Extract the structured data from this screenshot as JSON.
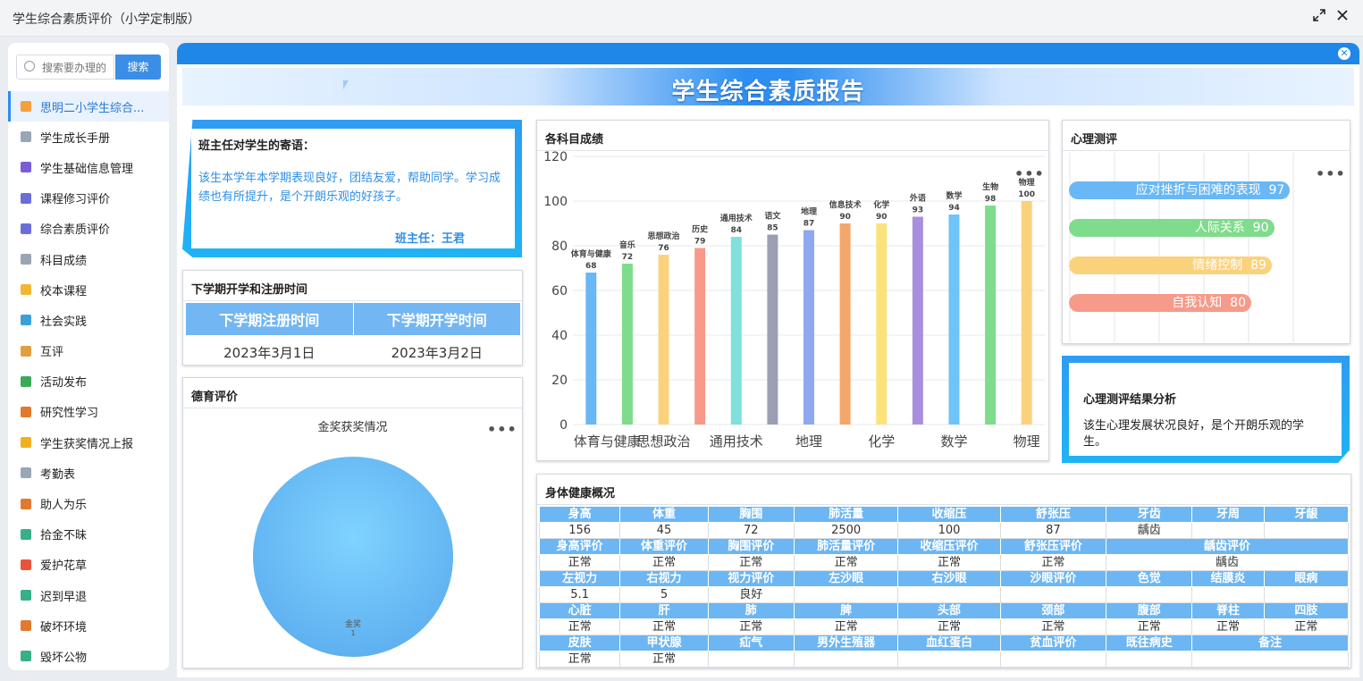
{
  "window": {
    "title": "学生综合素质评价（小学定制版）"
  },
  "sidebar": {
    "search_placeholder": "搜索要办理的",
    "search_button": "搜索",
    "items": [
      {
        "label": "思明二小学生综合...",
        "color": "#f5a03a"
      },
      {
        "label": "学生成长手册",
        "color": "#9aa5b5"
      },
      {
        "label": "学生基础信息管理",
        "color": "#7b5bd6"
      },
      {
        "label": "课程修习评价",
        "color": "#6a6fd8"
      },
      {
        "label": "综合素质评价",
        "color": "#6a6fd8"
      },
      {
        "label": "科目成绩",
        "color": "#9aa5b5"
      },
      {
        "label": "校本课程",
        "color": "#f2b630"
      },
      {
        "label": "社会实践",
        "color": "#3aa0d8"
      },
      {
        "label": "互评",
        "color": "#e0a040"
      },
      {
        "label": "活动发布",
        "color": "#3aaa5a"
      },
      {
        "label": "研究性学习",
        "color": "#e07a30"
      },
      {
        "label": "学生获奖情况上报",
        "color": "#f0b020"
      },
      {
        "label": "考勤表",
        "color": "#9aa5b5"
      },
      {
        "label": "助人为乐",
        "color": "#e07a30"
      },
      {
        "label": "拾金不昧",
        "color": "#35b089"
      },
      {
        "label": "爱护花草",
        "color": "#e8543a"
      },
      {
        "label": "迟到早退",
        "color": "#35b089"
      },
      {
        "label": "破坏环境",
        "color": "#e07a30"
      },
      {
        "label": "毁坏公物",
        "color": "#35b089"
      }
    ]
  },
  "report": {
    "title": "学生综合素质报告"
  },
  "teacher_comment": {
    "title": "班主任对学生的寄语：",
    "text": "该生本学年本学期表现良好，团结友爱，帮助同学。学习成绩也有所提升，是个开朗乐观的好孩子。",
    "signature": "班主任：王君"
  },
  "registration": {
    "title": "下学期开学和注册时间",
    "headers": [
      "下学期注册时间",
      "下学期开学时间"
    ],
    "values": [
      "2023年3月1日",
      "2023年3月2日"
    ]
  },
  "moral": {
    "title": "德育评价",
    "chart_title": "金奖获奖情况",
    "slice_label": "金奖",
    "slice_value": "1"
  },
  "scores": {
    "title": "各科目成绩",
    "more": "•••"
  },
  "psychology": {
    "title": "心理测评",
    "more": "•••",
    "bars": [
      {
        "label": "应对挫折与困难的表现",
        "value": "97"
      },
      {
        "label": "人际关系",
        "value": "90"
      },
      {
        "label": "情绪控制",
        "value": "89"
      },
      {
        "label": "自我认知",
        "value": "80"
      }
    ]
  },
  "analysis": {
    "title": "心理测评结果分析",
    "text": "该生心理发展状况良好，是个开朗乐观的学生。"
  },
  "health": {
    "title": "身体健康概况",
    "rows": [
      [
        "身高",
        "体重",
        "胸围",
        "肺活量",
        "收缩压",
        "舒张压",
        "牙齿",
        "牙周",
        "牙龈"
      ],
      [
        "156",
        "45",
        "72",
        "2500",
        "100",
        "87",
        "龋齿",
        "",
        ""
      ],
      [
        "身高评价",
        "体重评价",
        "胸围评价",
        "肺活量评价",
        "收缩压评价",
        "舒张压评价",
        "龋齿评价"
      ],
      [
        "正常",
        "正常",
        "正常",
        "正常",
        "正常",
        "正常",
        "龋齿"
      ],
      [
        "左视力",
        "右视力",
        "视力评价",
        "左沙眼",
        "右沙眼",
        "沙眼评价",
        "色觉",
        "结膜炎",
        "眼病"
      ],
      [
        "5.1",
        "5",
        "良好",
        "",
        "",
        "",
        "",
        "",
        ""
      ],
      [
        "心脏",
        "肝",
        "肺",
        "脾",
        "头部",
        "颈部",
        "腹部",
        "脊柱",
        "四肢"
      ],
      [
        "正常",
        "正常",
        "正常",
        "正常",
        "正常",
        "正常",
        "正常",
        "正常",
        "正常"
      ],
      [
        "皮肤",
        "甲状腺",
        "疝气",
        "男外生殖器",
        "血红蛋白",
        "贫血评价",
        "既往病史",
        "备注"
      ],
      [
        "正常",
        "正常",
        "",
        "",
        "",
        "",
        "",
        ""
      ]
    ]
  },
  "chart_data": [
    {
      "type": "bar",
      "title": "各科目成绩",
      "categories": [
        "体育与健康",
        "音乐",
        "思想政治",
        "历史",
        "通用技术",
        "语文",
        "地理",
        "信息技术",
        "化学",
        "外语",
        "数学",
        "生物",
        "物理"
      ],
      "values": [
        68,
        72,
        76,
        79,
        84,
        85,
        87,
        90,
        90,
        93,
        94,
        98,
        100
      ],
      "x_tick_labels": [
        "体育与健康",
        "思想政治",
        "通用技术",
        "地理",
        "化学",
        "数学",
        "物理"
      ],
      "colors": [
        "#6ab7f5",
        "#7fdc8c",
        "#fbd27c",
        "#f79a8a",
        "#7fe0dc",
        "#9c9fb3",
        "#8fa8ef",
        "#f5a66a",
        "#fbe37c",
        "#a78fdb",
        "#6ec4f7",
        "#7fdc8c",
        "#fbd27c"
      ],
      "ylim": [
        0,
        120
      ],
      "yticks": [
        0,
        20,
        40,
        60,
        80,
        100,
        120
      ],
      "grid": true
    },
    {
      "type": "bar",
      "orientation": "horizontal",
      "title": "心理测评",
      "categories": [
        "应对挫折与困难的表现",
        "人际关系",
        "情绪控制",
        "自我认知"
      ],
      "values": [
        97,
        90,
        89,
        80
      ],
      "colors": [
        "#6ab7f5",
        "#7fdc8c",
        "#fbd27c",
        "#f79a8a"
      ]
    },
    {
      "type": "pie",
      "title": "金奖获奖情况",
      "categories": [
        "金奖"
      ],
      "values": [
        1
      ],
      "colors": [
        "#5fb0f0"
      ]
    }
  ]
}
